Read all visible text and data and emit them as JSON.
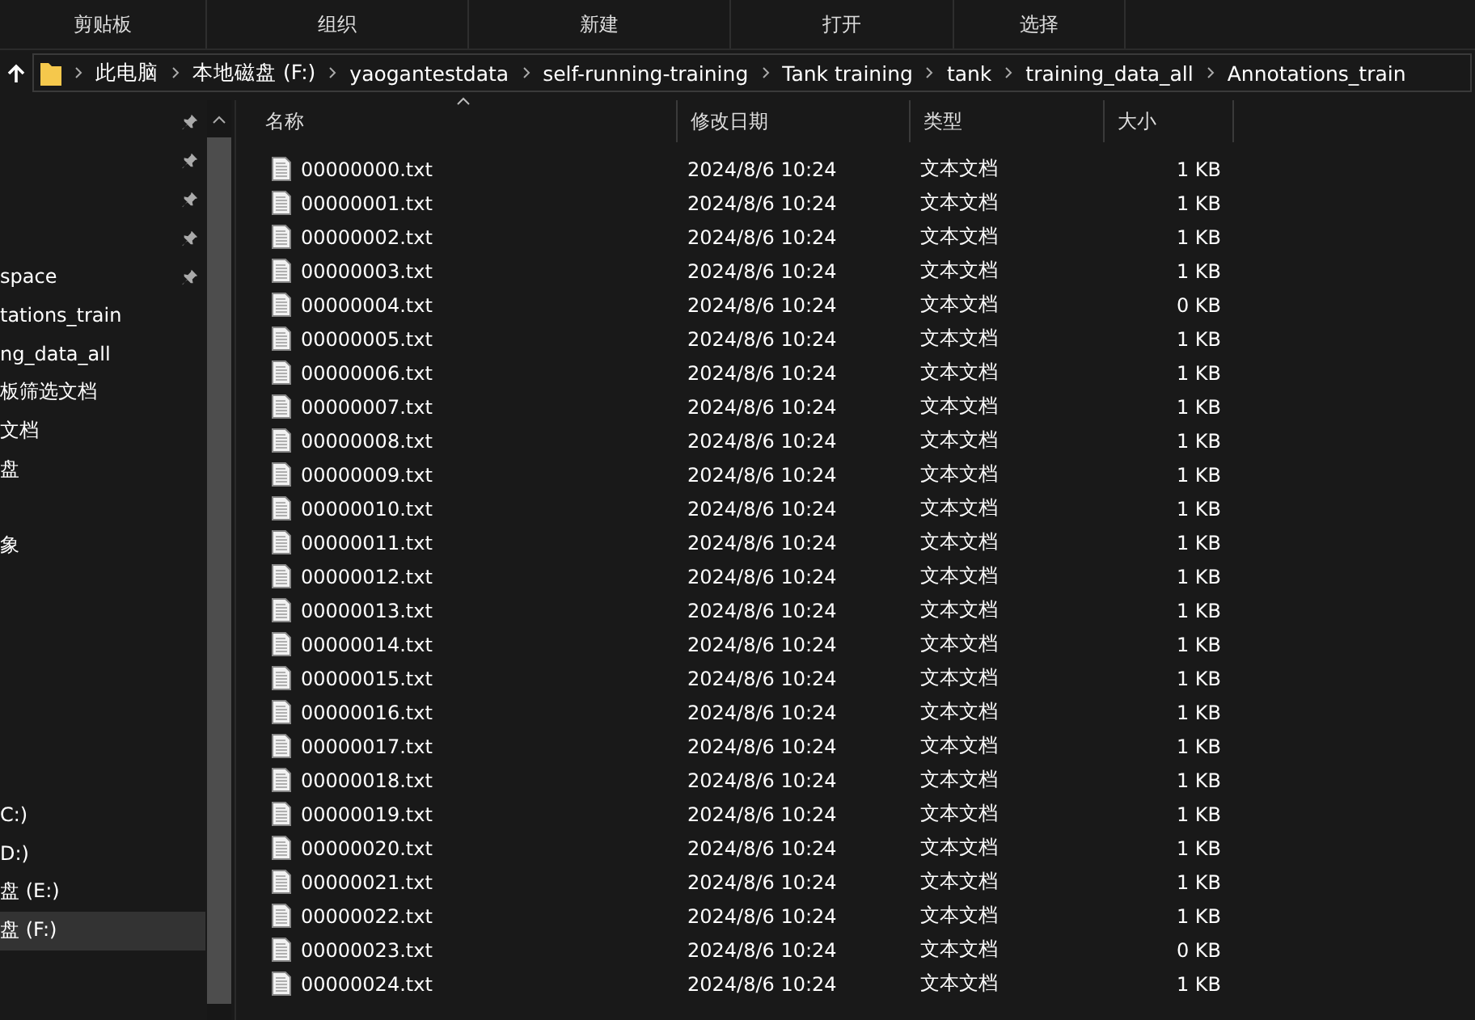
{
  "ribbon": [
    "剪贴板",
    "组织",
    "新建",
    "打开",
    "选择"
  ],
  "breadcrumb": [
    "此电脑",
    "本地磁盘 (F:)",
    "yaogantestdata",
    "self-running-training",
    "Tank training",
    "tank",
    "training_data_all",
    "Annotations_train"
  ],
  "sidebar": {
    "items": [
      {
        "kind": "item",
        "pinned": true,
        "selected": false
      },
      {
        "kind": "item",
        "pinned": true,
        "selected": false
      },
      {
        "kind": "item",
        "pinned": true,
        "selected": false
      },
      {
        "kind": "item",
        "pinned": true,
        "selected": false
      },
      {
        "label": "space",
        "pinned": true,
        "selected": false
      },
      {
        "label": "tations_train",
        "pinned": false,
        "selected": false
      },
      {
        "label": "ng_data_all",
        "pinned": false,
        "selected": false
      },
      {
        "label": "板筛选文档",
        "pinned": false,
        "selected": false
      },
      {
        "label": "文档",
        "pinned": false,
        "selected": false
      },
      {
        "label": "盘",
        "pinned": false,
        "selected": false
      },
      {
        "kind": "gap"
      },
      {
        "label": "象",
        "pinned": false,
        "selected": false
      },
      {
        "kind": "gap"
      },
      {
        "kind": "gap"
      },
      {
        "kind": "gap"
      },
      {
        "kind": "gap"
      },
      {
        "kind": "gap"
      },
      {
        "kind": "gap"
      },
      {
        "label": "C:)",
        "pinned": false,
        "selected": false
      },
      {
        "label": "D:)",
        "pinned": false,
        "selected": false
      },
      {
        "label": "盘 (E:)",
        "pinned": false,
        "selected": false
      },
      {
        "label": "盘 (F:)",
        "pinned": false,
        "selected": true
      }
    ]
  },
  "table": {
    "columns": [
      "名称",
      "修改日期",
      "类型",
      "大小"
    ],
    "rows": [
      [
        "00000000.txt",
        "2024/8/6 10:24",
        "文本文档",
        "1 KB"
      ],
      [
        "00000001.txt",
        "2024/8/6 10:24",
        "文本文档",
        "1 KB"
      ],
      [
        "00000002.txt",
        "2024/8/6 10:24",
        "文本文档",
        "1 KB"
      ],
      [
        "00000003.txt",
        "2024/8/6 10:24",
        "文本文档",
        "1 KB"
      ],
      [
        "00000004.txt",
        "2024/8/6 10:24",
        "文本文档",
        "0 KB"
      ],
      [
        "00000005.txt",
        "2024/8/6 10:24",
        "文本文档",
        "1 KB"
      ],
      [
        "00000006.txt",
        "2024/8/6 10:24",
        "文本文档",
        "1 KB"
      ],
      [
        "00000007.txt",
        "2024/8/6 10:24",
        "文本文档",
        "1 KB"
      ],
      [
        "00000008.txt",
        "2024/8/6 10:24",
        "文本文档",
        "1 KB"
      ],
      [
        "00000009.txt",
        "2024/8/6 10:24",
        "文本文档",
        "1 KB"
      ],
      [
        "00000010.txt",
        "2024/8/6 10:24",
        "文本文档",
        "1 KB"
      ],
      [
        "00000011.txt",
        "2024/8/6 10:24",
        "文本文档",
        "1 KB"
      ],
      [
        "00000012.txt",
        "2024/8/6 10:24",
        "文本文档",
        "1 KB"
      ],
      [
        "00000013.txt",
        "2024/8/6 10:24",
        "文本文档",
        "1 KB"
      ],
      [
        "00000014.txt",
        "2024/8/6 10:24",
        "文本文档",
        "1 KB"
      ],
      [
        "00000015.txt",
        "2024/8/6 10:24",
        "文本文档",
        "1 KB"
      ],
      [
        "00000016.txt",
        "2024/8/6 10:24",
        "文本文档",
        "1 KB"
      ],
      [
        "00000017.txt",
        "2024/8/6 10:24",
        "文本文档",
        "1 KB"
      ],
      [
        "00000018.txt",
        "2024/8/6 10:24",
        "文本文档",
        "1 KB"
      ],
      [
        "00000019.txt",
        "2024/8/6 10:24",
        "文本文档",
        "1 KB"
      ],
      [
        "00000020.txt",
        "2024/8/6 10:24",
        "文本文档",
        "1 KB"
      ],
      [
        "00000021.txt",
        "2024/8/6 10:24",
        "文本文档",
        "1 KB"
      ],
      [
        "00000022.txt",
        "2024/8/6 10:24",
        "文本文档",
        "1 KB"
      ],
      [
        "00000023.txt",
        "2024/8/6 10:24",
        "文本文档",
        "0 KB"
      ],
      [
        "00000024.txt",
        "2024/8/6 10:24",
        "文本文档",
        "1 KB"
      ]
    ]
  }
}
